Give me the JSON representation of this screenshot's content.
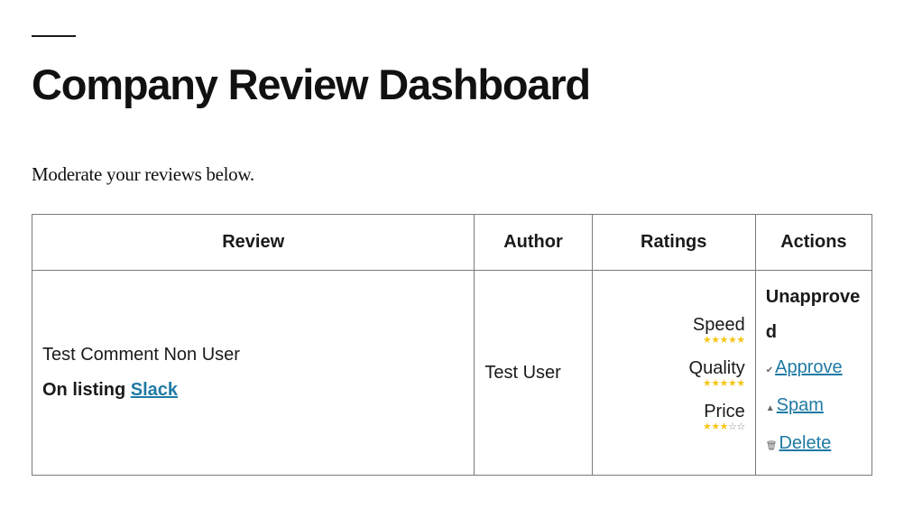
{
  "page": {
    "title": "Company Review Dashboard",
    "intro": "Moderate your reviews below."
  },
  "table": {
    "headers": {
      "review": "Review",
      "author": "Author",
      "ratings": "Ratings",
      "actions": "Actions"
    },
    "row": {
      "comment": "Test Comment Non User",
      "listing_prefix": "On listing",
      "listing_name": "Slack",
      "author": "Test User",
      "ratings": [
        {
          "label": "Speed",
          "stars": 5,
          "max": 5
        },
        {
          "label": "Quality",
          "stars": 5,
          "max": 5
        },
        {
          "label": "Price",
          "stars": 3,
          "max": 5
        }
      ],
      "status": "Unapproved",
      "actions": {
        "approve": "Approve",
        "spam": "Spam",
        "delete": "Delete"
      }
    }
  },
  "colors": {
    "star_filled": "#f5c61a",
    "link": "#1f7aa3"
  },
  "icons": {
    "approve": "check-icon",
    "spam": "warning-icon",
    "delete": "trash-icon"
  }
}
